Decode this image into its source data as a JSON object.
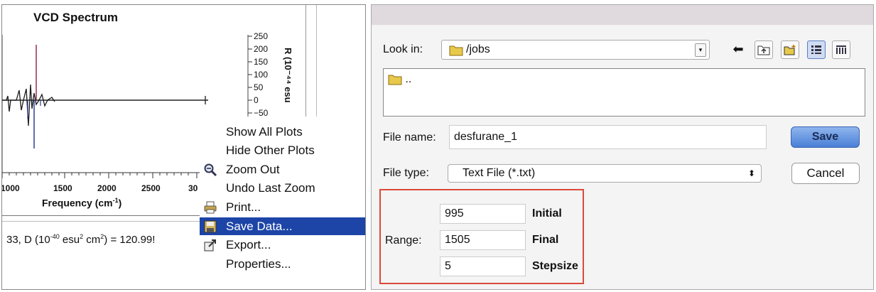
{
  "plot": {
    "title": "VCD Spectrum",
    "right_ticks": [
      "250",
      "200",
      "150",
      "100",
      "50",
      "0",
      "−50"
    ],
    "right_axis_label": "R (10⁻⁴⁴ esu",
    "x_ticks": [
      "1000",
      "1500",
      "2000",
      "2500",
      "30"
    ],
    "x_axis_label": "Frequency (cm",
    "x_axis_unit_sup": "-1",
    "x_axis_label_end": ")"
  },
  "status": {
    "prefix": "33, D (10",
    "exp1": "-40",
    "mid": " esu",
    "exp2": "2",
    "mid2": " cm",
    "exp3": "2",
    "suffix": ") = 120.99!"
  },
  "context_menu": {
    "items": [
      {
        "label": "Show All Plots",
        "icon": "none"
      },
      {
        "label": "Hide Other Plots",
        "icon": "none"
      },
      {
        "label": "Zoom Out",
        "icon": "magnifier-icon"
      },
      {
        "label": "Undo Last Zoom",
        "icon": "none"
      },
      {
        "label": "Print...",
        "icon": "printer-icon"
      },
      {
        "label": "Save Data...",
        "icon": "floppy-icon",
        "selected": true
      },
      {
        "label": "Export...",
        "icon": "export-icon"
      },
      {
        "label": "Properties...",
        "icon": "none"
      }
    ]
  },
  "dialog": {
    "look_in_label": "Look in:",
    "look_in_value": "/jobs",
    "file_list": [
      ".."
    ],
    "file_name_label": "File name:",
    "file_name_value": "desfurane_1",
    "file_type_label": "File type:",
    "file_type_value": "Text File (*.txt)",
    "save_label": "Save",
    "cancel_label": "Cancel",
    "range_label": "Range:",
    "range": {
      "initial_value": "995",
      "initial_label": "Initial",
      "final_value": "1505",
      "final_label": "Final",
      "step_value": "5",
      "step_label": "Stepsize"
    },
    "selected_color": "#1d45a8",
    "highlight_border_color": "#d94a3a"
  }
}
